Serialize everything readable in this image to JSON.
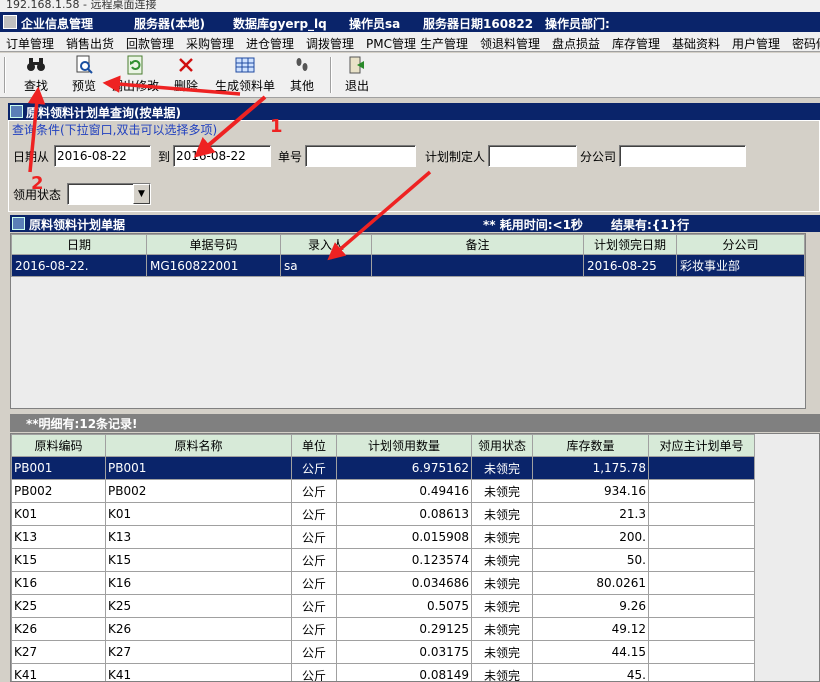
{
  "remote_title": "192.168.1.58 - 远程桌面连接",
  "status": {
    "company": "企业信息管理",
    "server": "服务器(本地)",
    "database": "数据库gyerp_lq",
    "operator": "操作员sa",
    "server_date": "服务器日期160822",
    "operator_dept": "操作员部门:"
  },
  "menu": [
    "订单管理",
    "销售出货",
    "回款管理",
    "采购管理",
    "进仓管理",
    "调拨管理",
    "PMC管理",
    "生产管理",
    "领退料管理",
    "盘点损益",
    "库存管理",
    "基础资料",
    "用户管理",
    "密码修"
  ],
  "toolbar": {
    "search": "查找",
    "preview": "预览",
    "fetch_edit": "调出修改",
    "delete": "删除",
    "generate": "生成领料单",
    "other": "其他",
    "exit": "退出"
  },
  "query": {
    "title": "原料领料计划单查询(按单据)",
    "legend": "查询条件(下拉窗口,双击可以选择多项)",
    "date_from_label": "日期从",
    "date_from": "2016-08-22",
    "date_to_label": "到",
    "date_to": "2016-08-22",
    "doc_no_label": "单号",
    "doc_no": "",
    "planner_label": "计划制定人",
    "planner": "",
    "branch_label": "分公司",
    "branch": "",
    "status_label": "领用状态",
    "status": ""
  },
  "plan": {
    "title": "原料领料计划单据",
    "elapsed": "** 耗用时间:<1秒",
    "result": "结果有:{1}行",
    "columns": [
      "日期",
      "单据号码",
      "录入人",
      "备注",
      "计划领完日期",
      "分公司"
    ],
    "rows": [
      [
        "2016-08-22.",
        "MG160822001",
        "sa",
        "",
        "2016-08-25",
        "彩妆事业部"
      ]
    ]
  },
  "detail": {
    "title": "**明细有:12条记录!",
    "columns": [
      "原料编码",
      "原料名称",
      "单位",
      "计划领用数量",
      "领用状态",
      "库存数量",
      "对应主计划单号"
    ],
    "rows": [
      [
        "PB001",
        "PB001",
        "公斤",
        "6.975162",
        "未领完",
        "1,175.78",
        ""
      ],
      [
        "PB002",
        "PB002",
        "公斤",
        "0.49416",
        "未领完",
        "934.16",
        ""
      ],
      [
        "K01",
        "K01",
        "公斤",
        "0.08613",
        "未领完",
        "21.3",
        ""
      ],
      [
        "K13",
        "K13",
        "公斤",
        "0.015908",
        "未领完",
        "200.",
        ""
      ],
      [
        "K15",
        "K15",
        "公斤",
        "0.123574",
        "未领完",
        "50.",
        ""
      ],
      [
        "K16",
        "K16",
        "公斤",
        "0.034686",
        "未领完",
        "80.0261",
        ""
      ],
      [
        "K25",
        "K25",
        "公斤",
        "0.5075",
        "未领完",
        "9.26",
        ""
      ],
      [
        "K26",
        "K26",
        "公斤",
        "0.29125",
        "未领完",
        "49.12",
        ""
      ],
      [
        "K27",
        "K27",
        "公斤",
        "0.03175",
        "未领完",
        "44.15",
        ""
      ],
      [
        "K41",
        "K41",
        "公斤",
        "0.08149",
        "未领完",
        "45.",
        ""
      ]
    ]
  },
  "annotations": [
    "1",
    "2"
  ],
  "colors": {
    "accent": "#0a246a",
    "annotation": "#ee2222",
    "header_bg": "#d7ead8"
  }
}
